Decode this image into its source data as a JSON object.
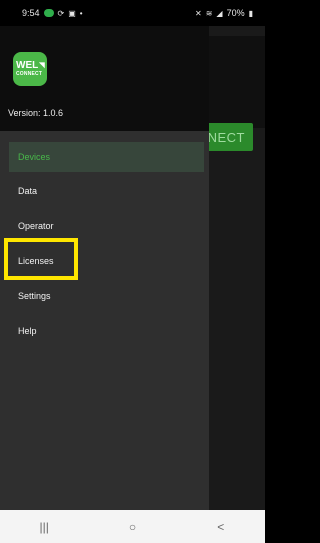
{
  "status_bar": {
    "time": "9:54",
    "notification_icons": [
      "chat-icon",
      "sync-icon",
      "image-icon",
      "dot-icon"
    ],
    "right_icons": [
      "mute-icon",
      "wifi-icon",
      "signal-icon"
    ],
    "battery": "70%"
  },
  "background_app": {
    "connect_button_label": "NECT"
  },
  "drawer": {
    "logo": {
      "line1": "WEL",
      "line2": "CONNECT"
    },
    "version": "Version: 1.0.6",
    "items": [
      {
        "label": "Devices",
        "active": true
      },
      {
        "label": "Data"
      },
      {
        "label": "Operator"
      },
      {
        "label": "Licenses"
      },
      {
        "label": "Settings"
      },
      {
        "label": "Help"
      }
    ]
  },
  "highlight": {
    "target": "Licenses",
    "color": "#ffe600"
  },
  "nav_bar": {
    "recents": "|||",
    "home": "○",
    "back": "<"
  },
  "colors": {
    "accent": "#48b94a",
    "drawer_bg": "#2f2f2f",
    "header_bg": "#0d0d0d"
  }
}
